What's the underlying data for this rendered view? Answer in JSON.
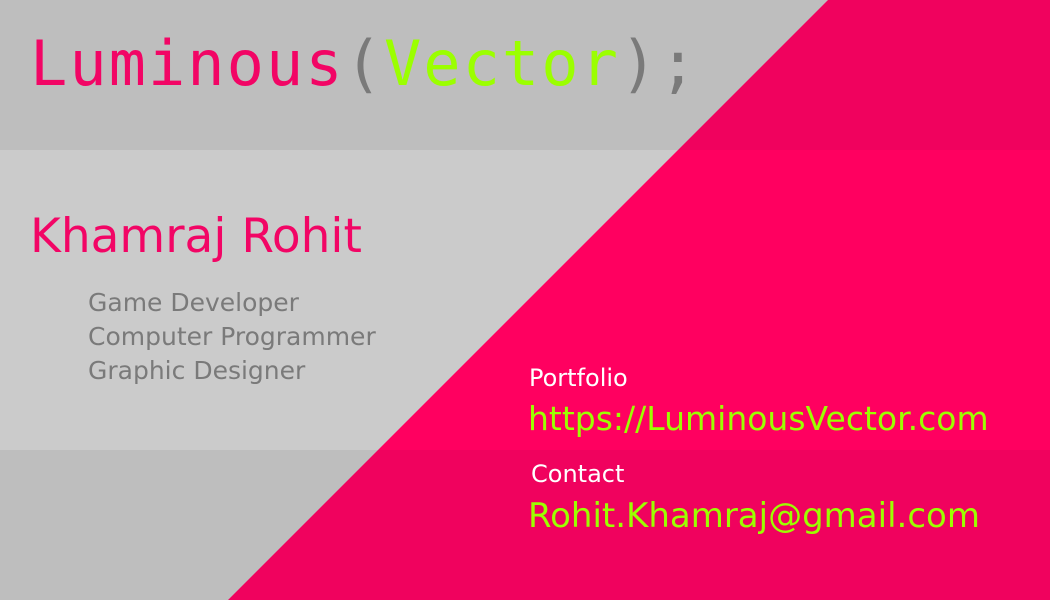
{
  "colors": {
    "band_top": "#bebebe",
    "band_mid": "#cbcbcb",
    "band_bottom": "#bebebe",
    "pink_top": "#f0025e",
    "pink_mid": "#ff0060",
    "pink_bottom": "#f0025e",
    "pink_text": "#f20565",
    "lime_text": "#9bff00",
    "gray_text": "#7a7a7a",
    "white_text": "#ffffff"
  },
  "brand": {
    "word1": "Luminous",
    "open_paren": "(",
    "word2": "Vector",
    "close": ");"
  },
  "person": {
    "name": "Khamraj Rohit",
    "roles": [
      "Game Developer",
      "Computer Programmer",
      "Graphic Designer"
    ]
  },
  "portfolio": {
    "label": "Portfolio",
    "url": "https://LuminousVector.com"
  },
  "contact": {
    "label": "Contact",
    "email": "Rohit.Khamraj@gmail.com"
  }
}
